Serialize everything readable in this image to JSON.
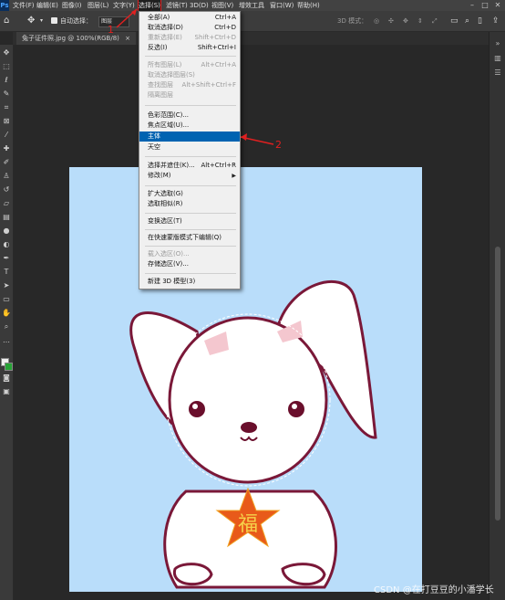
{
  "menubar": {
    "items": [
      "文件(F)",
      "编辑(E)",
      "图像(I)",
      "图层(L)",
      "文字(Y)",
      "选择(S)",
      "滤镜(T)",
      "3D(D)",
      "视图(V)",
      "增效工具",
      "窗口(W)",
      "帮助(H)"
    ],
    "active_index": 5
  },
  "options_bar": {
    "auto_select_label": "自动选择：",
    "auto_select_value": "图层",
    "mode_3d_label": "3D 模式："
  },
  "document_tab": {
    "title": "兔子证件照.jpg @ 100%(RGB/8)",
    "close": "×"
  },
  "select_menu": {
    "items": [
      {
        "label": "全部(A)",
        "shortcut": "Ctrl+A",
        "disabled": false
      },
      {
        "label": "取消选择(D)",
        "shortcut": "Ctrl+D",
        "disabled": false
      },
      {
        "label": "重新选择(E)",
        "shortcut": "Shift+Ctrl+D",
        "disabled": true
      },
      {
        "label": "反选(I)",
        "shortcut": "Shift+Ctrl+I",
        "disabled": false
      },
      {
        "label": "所有图层(L)",
        "shortcut": "Alt+Ctrl+A",
        "disabled": true
      },
      {
        "label": "取消选择图层(S)",
        "shortcut": "",
        "disabled": true
      },
      {
        "label": "查找图层",
        "shortcut": "Alt+Shift+Ctrl+F",
        "disabled": true
      },
      {
        "label": "隔离图层",
        "shortcut": "",
        "disabled": true
      },
      {
        "label": "色彩范围(C)...",
        "shortcut": "",
        "disabled": false
      },
      {
        "label": "焦点区域(U)...",
        "shortcut": "",
        "disabled": false
      },
      {
        "label": "主体",
        "shortcut": "",
        "disabled": false,
        "selected": true
      },
      {
        "label": "天空",
        "shortcut": "",
        "disabled": false
      },
      {
        "label": "选择并遮住(K)...",
        "shortcut": "Alt+Ctrl+R",
        "disabled": false
      },
      {
        "label": "修改(M)",
        "shortcut": "",
        "disabled": false,
        "submenu": true
      },
      {
        "label": "扩大选取(G)",
        "shortcut": "",
        "disabled": false
      },
      {
        "label": "选取相似(R)",
        "shortcut": "",
        "disabled": false
      },
      {
        "label": "变换选区(T)",
        "shortcut": "",
        "disabled": false
      },
      {
        "label": "在快速蒙版模式下编辑(Q)",
        "shortcut": "",
        "disabled": false
      },
      {
        "label": "载入选区(O)...",
        "shortcut": "",
        "disabled": true
      },
      {
        "label": "存储选区(V)...",
        "shortcut": "",
        "disabled": false
      },
      {
        "label": "新建 3D 模型(3)",
        "shortcut": "",
        "disabled": false
      }
    ]
  },
  "annotations": {
    "one": "1",
    "two": "2"
  },
  "canvas": {
    "star_char": "福",
    "background_color": "#b9ddfa",
    "outline_color": "#7a1838"
  },
  "watermark": "CSDN @在打豆豆的小潘学长",
  "colors": {
    "highlight": "#0063b1",
    "annotation": "#e02020",
    "foreground": "#f0f0f0",
    "background": "#27a336"
  }
}
